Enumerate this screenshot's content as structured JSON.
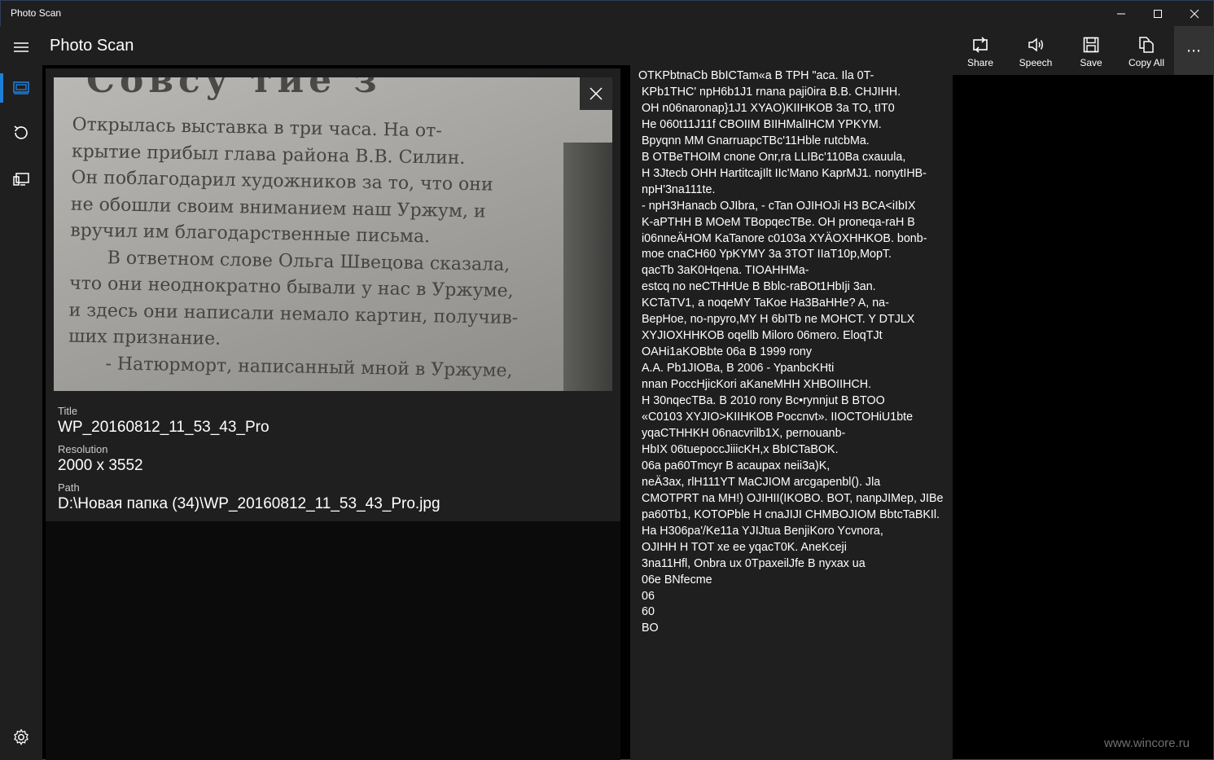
{
  "window": {
    "title": "Photo Scan"
  },
  "header": {
    "app_title": "Photo Scan"
  },
  "commands": [
    {
      "label": "Share",
      "icon": "share-icon"
    },
    {
      "label": "Speech",
      "icon": "speaker-icon"
    },
    {
      "label": "Save",
      "icon": "save-icon"
    },
    {
      "label": "Copy All",
      "icon": "copy-icon"
    }
  ],
  "more_label": "⋯",
  "sidebar": {
    "items": [
      {
        "icon": "hamburger-icon"
      },
      {
        "icon": "scan-icon",
        "active": true
      },
      {
        "icon": "history-icon"
      },
      {
        "icon": "projector-icon"
      },
      {
        "icon": "gear-icon"
      }
    ]
  },
  "photo": {
    "heading_fragment": "Совсу тие з",
    "lines": [
      "Открылась выставка в три часа. На от-",
      "крытие прибыл глава района В.В. Силин.",
      "Он поблагодарил художников за то, что они",
      "не обошли своим вниманием наш Уржум, и",
      "вручил им благодарственные письма.",
      "В ответном слове Ольга Швецова сказала,",
      "что они неоднократно бывали у нас в Уржуме,",
      "и здесь они написали немало картин, получив-",
      "ших признание.",
      "- Натюрморт, написанный мной в Уржуме,"
    ]
  },
  "meta": {
    "title_label": "Title",
    "title_value": "WP_20160812_11_53_43_Pro",
    "resolution_label": "Resolution",
    "resolution_value": "2000 x 3552",
    "path_label": "Path",
    "path_value": "D:\\Новая папка (34)\\WP_20160812_11_53_43_Pro.jpg"
  },
  "ocr_lines": [
    "OTKPbtnaCb BbICTam«a B TPH \"aca. Ila 0T-",
    "KPb1THC' npH6b1J1 rnana paji0ira B.B. CHJIHH.",
    "OH n06naronap}1J1 XYAO)KIIHKOB 3a TO, tIT0",
    "He 060t11J11f CBOIIM BIIHMalIHCM YPKYM.",
    "Bpyqnn MM GnarruapcTBc'11Hble rutcbMa.",
    "B OTBeTHOIM cnone Onr,ra LLIBc'110Ba cxauula,",
    "H 3Jtecb OHH HartitcajIlt IIc'Mano KaprMJ1. nonytIHB-",
    "npH'3na111te.",
    "- npH3Hanacb OJIbra, - cTan OJIHOJi H3 BCA<iIbIX",
    "K-aPTHH B MOeM TBopqecTBe. OH proneqa-raH B",
    "i06nneÄHOM KaTanore c0103a XYÄOXHHKOB. bonb-",
    "moe cnaCH60 YpKYMY 3a 3TOT IIaT10p,MopT.",
    "qacTb 3aK0Hqena. TIOAHHMa-",
    "estcq no neCTHHUe B Bblc-raBOt1HbIji 3an.",
    "KCTaTV1, a noqeMY TaKoe Ha3BaHHe? A, na-",
    "BepHoe, no-npyro,MY H 6bITb ne MOHCT. Y DTJLX",
    "XYJIOXHHKOB oqellb Miloro 06mero. EloqTJt",
    "OAHi1aKOBbte 06a B 1999 rony",
    "A.A. Pb1JIOBa, B 2006 - YpanbcKHti",
    "nnan PoccHjicKori aKaneMHH XHBOIIHCH.",
    "H 30nqecTBa. B 2010 rony Bc•rynnjut B BTOO",
    "«C0103 XYJIO>KIIHKOB Poccnvt». IIOCTOHiU1bte",
    "yqaCTHHKH 06nacvrilb1X, pernouanb-",
    "HbIX 06tuepoccJiiicKH,x BbICTaBOK.",
    "06a pa60Tmcyr B acaupax neii3a)K,",
    "neÄ3ax, rlH111YT MaCJIOM arcgapenbl(). Jla",
    "CMOTPRT na MH!) OJIHII(IKOBO. BOT, nanpJIMep, JIBe",
    "pa60Tb1, KOTOPble H cnaJIJI CHMBOJIOM BbtcTaBKIl.",
    "Ha H306pa'/Ke11a YJIJtua BenjiKoro Ycvnora,",
    "OJIHH H TOT xe ee yqacT0K. AneKceji",
    "3na11Hfl, Onbra ux 0TpaxeilJfe B nyxax ua",
    "06e BNfecme",
    "06",
    "60",
    "BO"
  ],
  "watermark": "www.wincore.ru"
}
